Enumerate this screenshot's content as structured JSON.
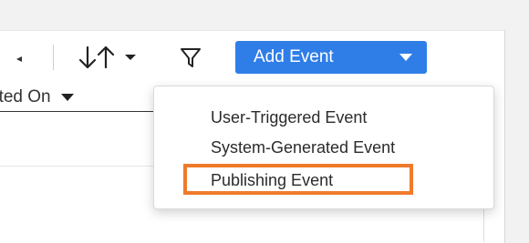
{
  "toolbar": {
    "add_event_label": "Add Event",
    "icons": {
      "previous": "caret-left-icon",
      "sort": "sort-arrows-icon",
      "sort_caret": "caret-down-icon",
      "filter": "filter-funnel-icon",
      "add_event_caret": "caret-down-icon"
    },
    "colors": {
      "primary_button": "#2f7ee8",
      "highlight_border": "#f07a2c"
    }
  },
  "sort_select": {
    "value": "ated On",
    "caret_icon": "caret-down-icon"
  },
  "add_event_menu": {
    "items": [
      {
        "label": "User-Triggered Event"
      },
      {
        "label": "System-Generated Event"
      },
      {
        "label": "Publishing Event"
      }
    ],
    "highlighted_item": "Publishing Event"
  }
}
